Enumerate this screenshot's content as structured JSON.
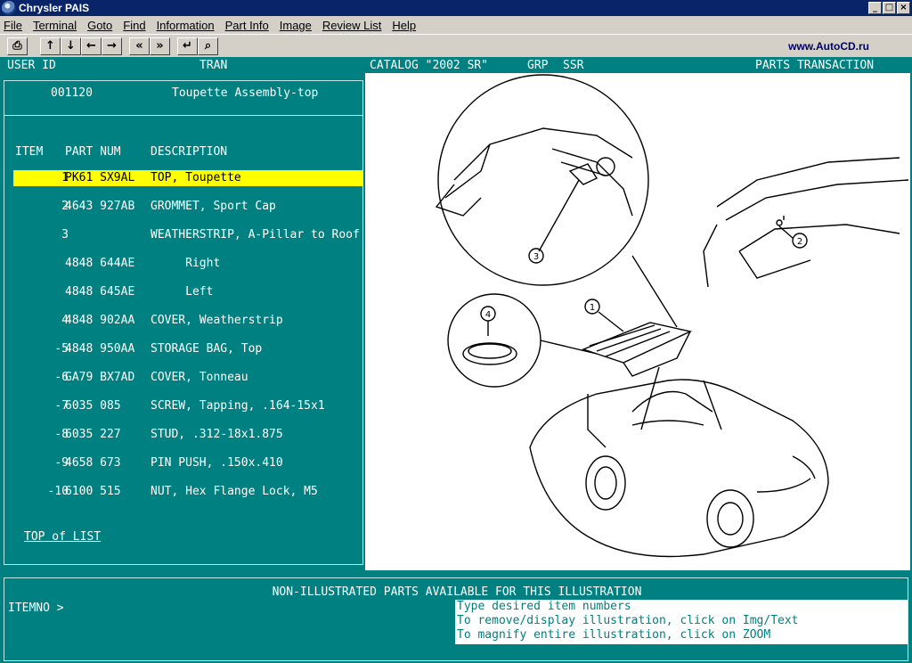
{
  "window": {
    "title": "Chrysler PAIS",
    "controls": [
      "_",
      "□",
      "×"
    ]
  },
  "menu": [
    {
      "label": "File"
    },
    {
      "label": "Terminal"
    },
    {
      "label": "Goto"
    },
    {
      "label": "Find"
    },
    {
      "label": "Information"
    },
    {
      "label": "Part Info"
    },
    {
      "label": "Image"
    },
    {
      "label": "Review List"
    },
    {
      "label": "Help"
    }
  ],
  "toolbar": {
    "print": "⎙",
    "up": "↑",
    "down": "↓",
    "left": "←",
    "right": "→",
    "prev_page": "«",
    "next_page": "»",
    "enter": "↵",
    "zoom": "⌕",
    "site_url": "www.AutoCD.ru"
  },
  "status": {
    "user_id": "USER ID",
    "tran": "TRAN",
    "catalog": "CATALOG \"2002 SR\"",
    "grp": "GRP",
    "ssr": "SSR",
    "parts_transaction": "PARTS TRANSACTION"
  },
  "assembly": {
    "number": "001120",
    "name": "Toupette Assembly-top"
  },
  "columns": {
    "item": "ITEM",
    "part": "PART NUM",
    "description": "DESCRIPTION"
  },
  "parts": [
    {
      "item": "1",
      "part": "PK61 SX9AL",
      "desc": "TOP, Toupette",
      "selected": true
    },
    {
      "item": "2",
      "part": "4643 927AB",
      "desc": "GROMMET, Sport Cap"
    },
    {
      "item": "3",
      "part": "",
      "desc": "WEATHERSTRIP, A-Pillar to Roof"
    },
    {
      "item": "",
      "part": "4848 644AE",
      "desc": "     Right"
    },
    {
      "item": "",
      "part": "4848 645AE",
      "desc": "     Left"
    },
    {
      "item": "4",
      "part": "4848 902AA",
      "desc": "COVER, Weatherstrip"
    },
    {
      "item": "-5",
      "part": "4848 950AA",
      "desc": "STORAGE BAG, Top"
    },
    {
      "item": "-6",
      "part": "GA79 BX7AD",
      "desc": "COVER, Tonneau"
    },
    {
      "item": "-7",
      "part": "6035 085",
      "desc": "SCREW, Tapping, .164-15x1"
    },
    {
      "item": "-8",
      "part": "6035 227",
      "desc": "STUD, .312-18x1.875"
    },
    {
      "item": "-9",
      "part": "4658 673",
      "desc": "PIN PUSH, .150x.410"
    },
    {
      "item": "-10",
      "part": "6100 515",
      "desc": "NUT, Hex Flange Lock, M5"
    }
  ],
  "top_of_list": "TOP of LIST",
  "illustration": {
    "callouts": [
      "1",
      "2",
      "3",
      "4"
    ]
  },
  "bottom": {
    "non_illustrated": "NON-ILLUSTRATED PARTS AVAILABLE FOR THIS ILLUSTRATION",
    "itemno_prompt": "ITEMNO >",
    "help_lines": [
      "Type desired item numbers",
      "To remove/display illustration, click on Img/Text",
      "To magnify entire illustration, click on ZOOM"
    ]
  }
}
